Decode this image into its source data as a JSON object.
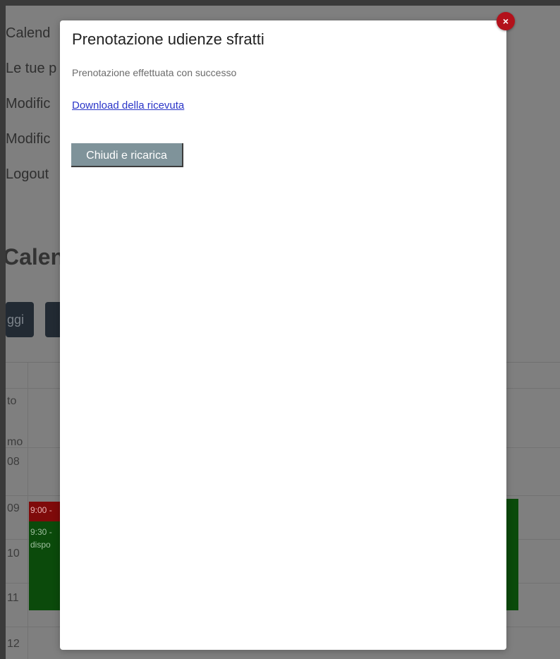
{
  "background": {
    "sidebar_links": [
      "Calend",
      "Le tue p",
      "Modific",
      "Modific",
      "Logout"
    ],
    "calendar_heading": "Calen",
    "calendar_buttons": [
      "ggi",
      ""
    ],
    "time_labels": [
      "to",
      "mo",
      "08",
      "09",
      "10",
      "11",
      "12"
    ],
    "events": {
      "red_label": "9:00 -",
      "green_label_1": "9:30 -",
      "green_label_2": "dispo"
    }
  },
  "modal": {
    "title": "Prenotazione udienze sfratti",
    "message": "Prenotazione effettuata con successo",
    "download_link": "Download della ricevuta",
    "close_reload_button": "Chiudi e ricarica",
    "close_icon": "×"
  },
  "colors": {
    "overlay": "#7f7f7f",
    "close_button": "#b3111b",
    "primary_button": "#7f939a",
    "link": "#2a35c8"
  }
}
